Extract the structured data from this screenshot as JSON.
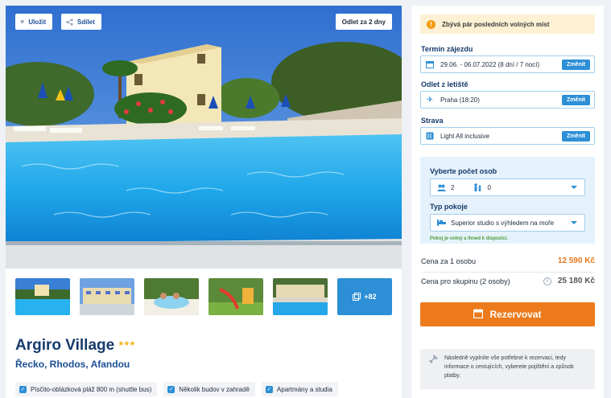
{
  "hero": {
    "save_label": "Uložit",
    "share_label": "Sdílet",
    "departure_badge": "Odlet za 2 dny"
  },
  "gallery": {
    "more_label": "+82"
  },
  "hotel": {
    "name": "Argiro Village",
    "stars": "★★★",
    "location": "Řecko, Rhodos, Afandou",
    "tags": [
      "Písčito-oblázková pláž 800 m (shuttle bus)",
      "Několik budov v zahradě",
      "Apartmány a studia"
    ]
  },
  "booking": {
    "alert": "Zbývá pár posledních volných míst",
    "term": {
      "label": "Termín zájezdu",
      "value": "29.06. - 06.07.2022 (8 dní / 7 nocí)",
      "change": "Změnit"
    },
    "departure": {
      "label": "Odlet z letiště",
      "value": "Praha (18:20)",
      "change": "Změnit"
    },
    "board": {
      "label": "Strava",
      "value": "Light All inclusive",
      "change": "Změnit"
    },
    "persons": {
      "label": "Vyberte počet osob",
      "adults": "2",
      "children": "0",
      "room_label": "Typ pokoje",
      "room_value": "Superior studio s výhledem na moře",
      "availability": "Pokoj je volný a ihned k dispozici."
    },
    "price_person_label": "Cena za 1 osobu",
    "price_person": "12 590 Kč",
    "price_group_label": "Cena pro skupinu (2 osoby)",
    "price_group": "25 180 Kč",
    "book_label": "Rezervovat",
    "note": "Následně vyplníte vše potřebné k rezervaci, tedy informace o cestujících, vyberete pojištění a způsob platby."
  },
  "colors": {
    "brand_blue": "#1c4f96",
    "accent_orange": "#ec7a1c",
    "field_border": "#9fcfee"
  }
}
